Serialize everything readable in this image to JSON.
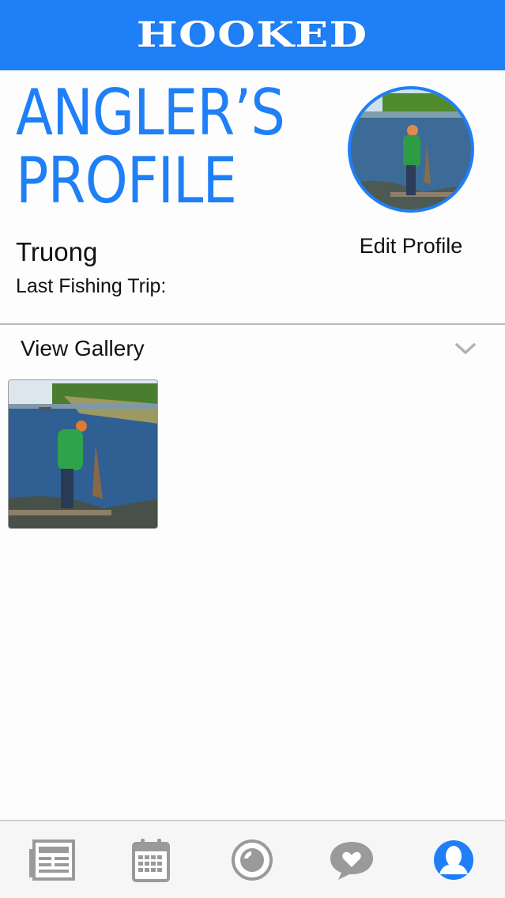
{
  "header": {
    "brand": "HOOKED"
  },
  "profile": {
    "title_line1": "ANGLER’S",
    "title_line2": "PROFILE",
    "name": "Truong",
    "last_trip_label": "Last Fishing Trip:",
    "edit_label": "Edit Profile"
  },
  "gallery": {
    "label": "View Gallery"
  },
  "tabs": [
    "news-icon",
    "calendar-icon",
    "camera-icon",
    "chat-icon",
    "profile-icon"
  ],
  "colors": {
    "accent": "#1f7ff7",
    "tab_inactive": "#9a9a9a"
  }
}
